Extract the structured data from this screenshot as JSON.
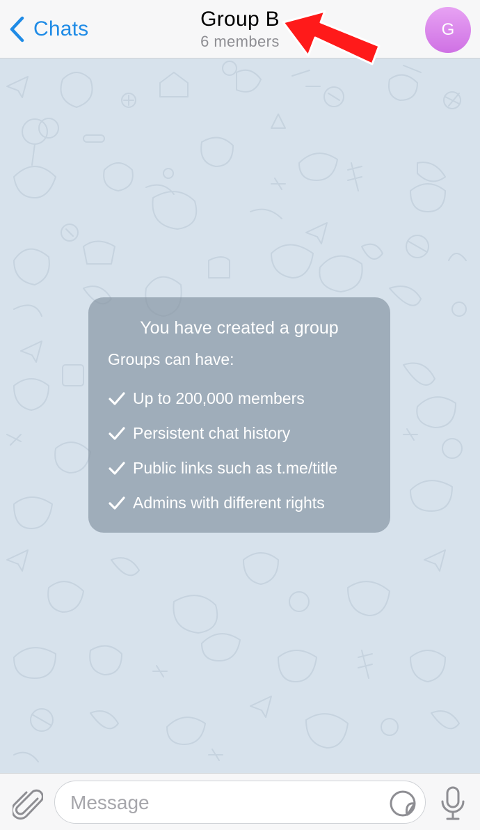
{
  "header": {
    "back_label": "Chats",
    "title": "Group B",
    "subtitle": "6 members",
    "avatar_initial": "G",
    "avatar_color": "#d97eea",
    "accent_color": "#1f8be6"
  },
  "annotation": {
    "icon": "red-arrow-icon",
    "color": "#ff1a1a"
  },
  "chat": {
    "background_color": "#d7e2ec",
    "info_card": {
      "title": "You have created a group",
      "subtitle": "Groups can have:",
      "features": [
        "Up to 200,000 members",
        "Persistent chat history",
        "Public links such as t.me/title",
        "Admins with different rights"
      ]
    }
  },
  "input_bar": {
    "placeholder": "Message",
    "icons": [
      "paperclip-icon",
      "sticker-icon",
      "microphone-icon"
    ]
  }
}
